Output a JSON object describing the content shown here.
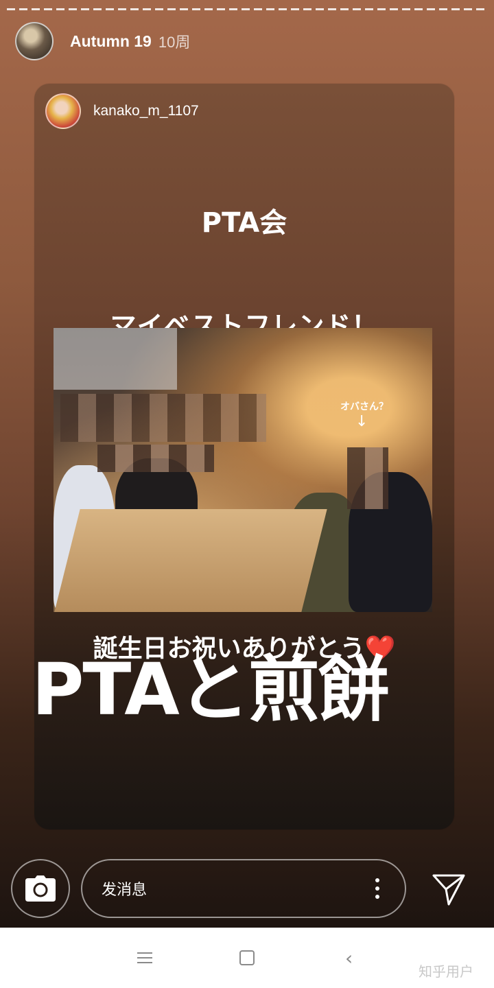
{
  "story": {
    "username": "Autumn 19",
    "time": "10周"
  },
  "shared_post": {
    "username": "kanako_m_1107",
    "line1": "PTA会",
    "line2": "マイベストフレンド！",
    "photo_annotation": "オバさん？",
    "line3": "誕生日お祝いありがとう",
    "line3_emoji": "❤️",
    "overlay_text": "PTAと煎餅"
  },
  "reply": {
    "placeholder": "发消息"
  },
  "icons": {
    "camera": "camera-icon",
    "more": "more-vertical-icon",
    "send": "send-icon",
    "nav_menu": "menu-icon",
    "nav_home": "home-icon",
    "nav_back": "back-icon"
  },
  "watermark": "知乎用户"
}
